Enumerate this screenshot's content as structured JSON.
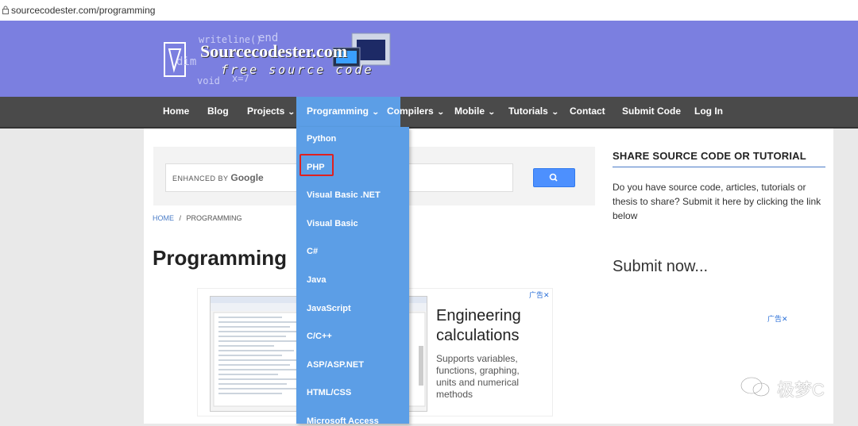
{
  "browser": {
    "url": "sourcecodester.com/programming"
  },
  "logo": {
    "title": "Sourcecodester.com",
    "subtitle": "free source code",
    "decor_words": [
      "writeline()",
      "end",
      "dim",
      "void",
      "x=7"
    ]
  },
  "nav": {
    "items": [
      {
        "label": "Home",
        "has_menu": false
      },
      {
        "label": "Blog",
        "has_menu": false
      },
      {
        "label": "Projects",
        "has_menu": true
      },
      {
        "label": "Programming",
        "has_menu": true,
        "active": true
      },
      {
        "label": "Compilers",
        "has_menu": true
      },
      {
        "label": "Mobile",
        "has_menu": true
      },
      {
        "label": "Tutorials",
        "has_menu": true
      },
      {
        "label": "Contact",
        "has_menu": false
      },
      {
        "label": "Submit Code",
        "has_menu": false
      },
      {
        "label": "Log In",
        "has_menu": false
      }
    ]
  },
  "dropdown": {
    "items": [
      "Python",
      "PHP",
      "Visual Basic .NET",
      "Visual Basic",
      "C#",
      "Java",
      "JavaScript",
      "C/C++",
      "ASP/ASP.NET",
      "HTML/CSS",
      "Microsoft Access"
    ],
    "highlighted": "PHP"
  },
  "search": {
    "label_prefix": "ENHANCED BY",
    "label_brand": "Google"
  },
  "breadcrumb": {
    "home": "HOME",
    "separator": "/",
    "current": "PROGRAMMING"
  },
  "page_title": "Programming",
  "ad": {
    "headline_line1": "Engineering",
    "headline_line2": "calculations",
    "body": "Supports variables, functions, graphing, units and numerical methods",
    "tag": "广告"
  },
  "sidebar": {
    "heading": "SHARE SOURCE CODE OR TUTORIAL",
    "text": "Do you have source code, articles, tutorials or thesis to share? Submit it here by clicking the link below",
    "submit": "Submit now...",
    "ad_tag": "广告"
  },
  "watermark": {
    "text": "极梦C"
  },
  "colors": {
    "header": "#7b7fe0",
    "navbar": "#4a4a4a",
    "accent": "#5c9ee6",
    "highlight": "#e0201f"
  }
}
